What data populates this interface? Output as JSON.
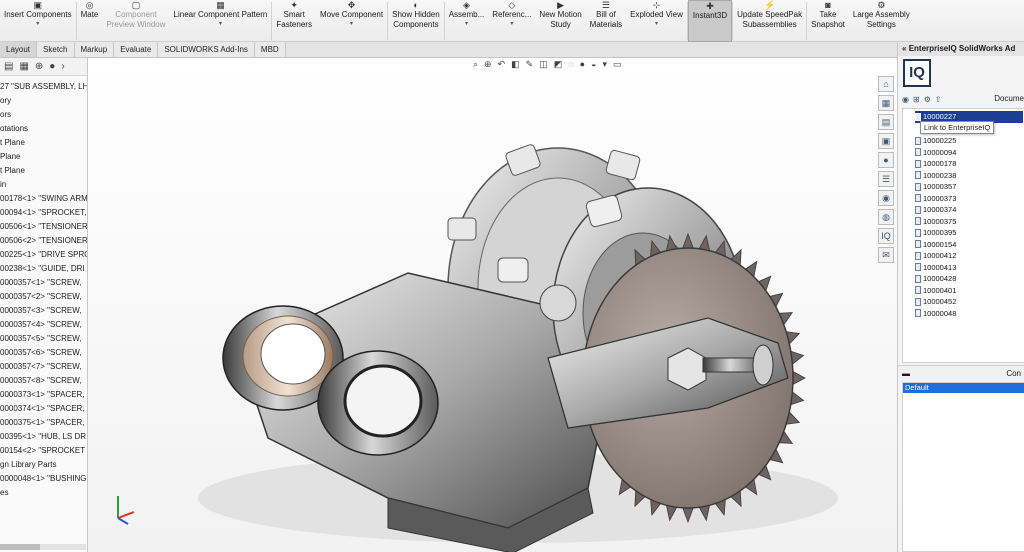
{
  "toolbar": {
    "buttons": [
      {
        "icon": "insert-components-icon",
        "label": "Insert Components",
        "caret": "▾"
      },
      {
        "icon": "mate-icon",
        "label": "Mate",
        "caret": ""
      },
      {
        "icon": "component-preview-icon",
        "label": "Component\nPreview Window",
        "caret": ""
      },
      {
        "icon": "linear-pattern-icon",
        "label": "Linear Component Pattern",
        "caret": "▾"
      },
      {
        "icon": "smart-fasteners-icon",
        "label": "Smart\nFasteners",
        "caret": ""
      },
      {
        "icon": "move-component-icon",
        "label": "Move Component",
        "caret": "▾"
      },
      {
        "icon": "show-hidden-icon",
        "label": "Show Hidden\nComponents",
        "caret": ""
      },
      {
        "icon": "assembly-features-icon",
        "label": "Assemb...",
        "caret": "▾"
      },
      {
        "icon": "reference-geometry-icon",
        "label": "Referenc...",
        "caret": "▾"
      },
      {
        "icon": "motion-study-icon",
        "label": "New Motion\nStudy",
        "caret": ""
      },
      {
        "icon": "bom-icon",
        "label": "Bill of\nMaterials",
        "caret": ""
      },
      {
        "icon": "exploded-view-icon",
        "label": "Exploded View",
        "caret": "▾"
      },
      {
        "icon": "instant3d-icon",
        "label": "Instant3D",
        "caret": ""
      },
      {
        "icon": "speedpak-icon",
        "label": "Update SpeedPak\nSubassemblies",
        "caret": ""
      },
      {
        "icon": "snapshot-icon",
        "label": "Take\nSnapshot",
        "caret": ""
      },
      {
        "icon": "large-assembly-icon",
        "label": "Large Assembly\nSettings",
        "caret": ""
      }
    ]
  },
  "tabs": [
    "Layout",
    "Sketch",
    "Markup",
    "Evaluate",
    "SOLIDWORKS Add-Ins",
    "MBD"
  ],
  "left_panel": {
    "icons": [
      "feature-manager-icon",
      "property-manager-icon",
      "config-manager-icon",
      "appearance-icon"
    ],
    "expand_glyph": "›",
    "tree": [
      "27 \"SUB ASSEMBLY, LH",
      "ory",
      "ors",
      "otations",
      "t Plane",
      "Plane",
      "t Plane",
      "in",
      "00178<1> \"SWING ARM",
      "00094<1> \"SPROCKET,",
      "00506<1> \"TENSIONER",
      "00506<2> \"TENSIONER",
      "00225<1> \"DRIVE SPRO",
      "00238<1> \"GUIDE, DRI",
      "0000357<1> \"SCREW,",
      "0000357<2> \"SCREW,",
      "0000357<3> \"SCREW,",
      "0000357<4> \"SCREW,",
      "0000357<5> \"SCREW,",
      "0000357<6> \"SCREW,",
      "0000357<7> \"SCREW,",
      "0000357<8> \"SCREW,",
      "0000373<1> \"SPACER,",
      "0000374<1> \"SPACER,",
      "0000375<1> \"SPACER,",
      "00395<1> \"HUB, LS DR",
      "00154<2> \"SPROCKET",
      "gn Library Parts",
      "0000048<1> \"BUSHING",
      "es"
    ]
  },
  "view_toolbar": [
    "zoom-fit-icon",
    "zoom-area-icon",
    "previous-view-icon",
    "section-view-icon",
    "dynamic-annotation-icon",
    "view-orientation-icon",
    "display-style-icon",
    "hide-show-icon",
    "edit-appearance-icon",
    "scene-icon",
    "view-settings-icon",
    "display-monitor-icon"
  ],
  "right_panel": {
    "title": "EnterpriseIQ SolidWorks Ad",
    "logo_text": "IQ",
    "document_header": "Docume",
    "tooltip": "Link to EnterpriseIQ",
    "tree_root": "10000227",
    "tree_items": [
      "10000225",
      "10000094",
      "10000178",
      "10000238",
      "10000357",
      "10000373",
      "10000374",
      "10000375",
      "10000395",
      "10000154",
      "10000412",
      "10000413",
      "10000428",
      "10000401",
      "10000452",
      "10000048"
    ],
    "lower_header": "Con",
    "lower_collapse": "▬",
    "lower_list": [
      "Default"
    ]
  },
  "task_strip": [
    "home-icon",
    "parts-icon",
    "file-explorer-icon",
    "view-palette-icon",
    "appearances-icon",
    "custom-properties-icon",
    "solidworks-resources-icon",
    "design-library-icon",
    "enterpriseiq-icon",
    "forum-icon"
  ]
}
